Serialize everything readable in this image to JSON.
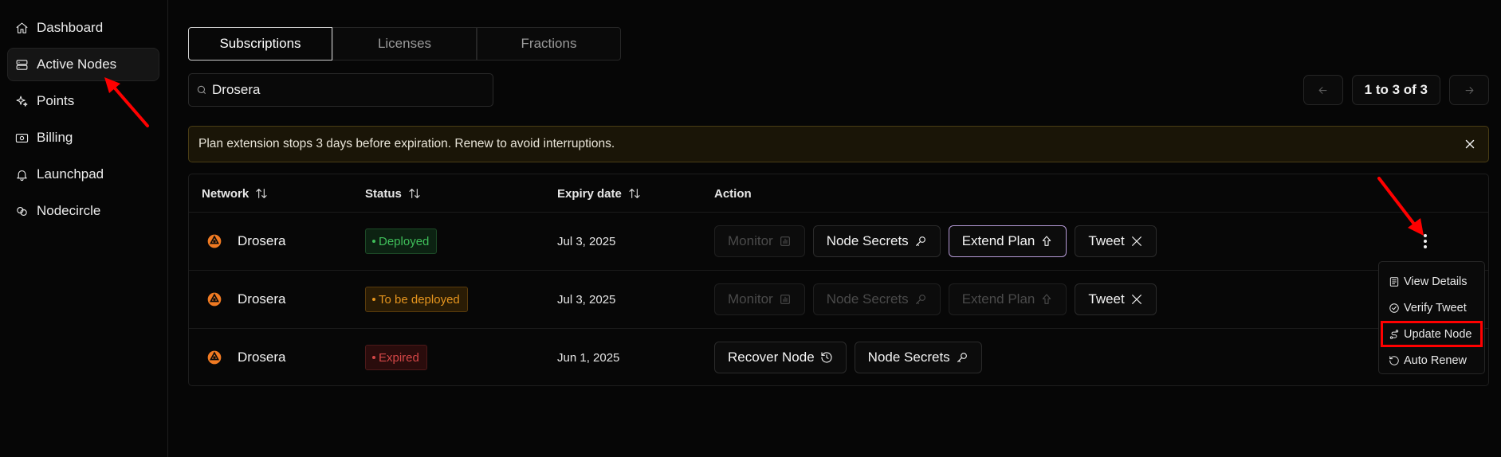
{
  "sidebar": {
    "items": [
      {
        "label": "Dashboard",
        "icon": "home-icon"
      },
      {
        "label": "Active Nodes",
        "icon": "server-icon",
        "active": true
      },
      {
        "label": "Points",
        "icon": "sparkles-icon"
      },
      {
        "label": "Billing",
        "icon": "banknote-icon"
      },
      {
        "label": "Launchpad",
        "icon": "bell-icon"
      },
      {
        "label": "Nodecircle",
        "icon": "circles-icon"
      }
    ]
  },
  "tabs": [
    {
      "label": "Subscriptions",
      "active": true
    },
    {
      "label": "Licenses"
    },
    {
      "label": "Fractions"
    }
  ],
  "search": {
    "value": "Drosera"
  },
  "pagination": {
    "summary": "1 to 3 of 3"
  },
  "alert": {
    "text": "Plan extension stops 3 days before expiration. Renew to avoid interruptions."
  },
  "table": {
    "headers": {
      "network": "Network",
      "status": "Status",
      "expiry": "Expiry date",
      "action": "Action"
    },
    "rows": [
      {
        "network": "Drosera",
        "status": "Deployed",
        "expiry": "Jul 3, 2025",
        "actions": [
          "Monitor",
          "Node Secrets",
          "Extend Plan",
          "Tweet"
        ]
      },
      {
        "network": "Drosera",
        "status": "To be deployed",
        "expiry": "Jul 3, 2025",
        "actions": [
          "Monitor",
          "Node Secrets",
          "Extend Plan",
          "Tweet"
        ]
      },
      {
        "network": "Drosera",
        "status": "Expired",
        "expiry": "Jun 1, 2025",
        "actions": [
          "Recover Node",
          "Node Secrets"
        ]
      }
    ]
  },
  "menu": {
    "items": [
      {
        "label": "View Details",
        "icon": "document-icon"
      },
      {
        "label": "Verify Tweet",
        "icon": "check-circle-icon"
      },
      {
        "label": "Update Node",
        "icon": "route-icon",
        "highlighted": true
      },
      {
        "label": "Auto Renew",
        "icon": "rotate-ccw-icon"
      }
    ]
  },
  "colors": {
    "accent_warning": "#4a3d14",
    "deployed": "#3fbf5a",
    "pending": "#e6951e",
    "expired": "#d54747",
    "annotation": "#ff0000",
    "network_logo": "#f07a22"
  }
}
